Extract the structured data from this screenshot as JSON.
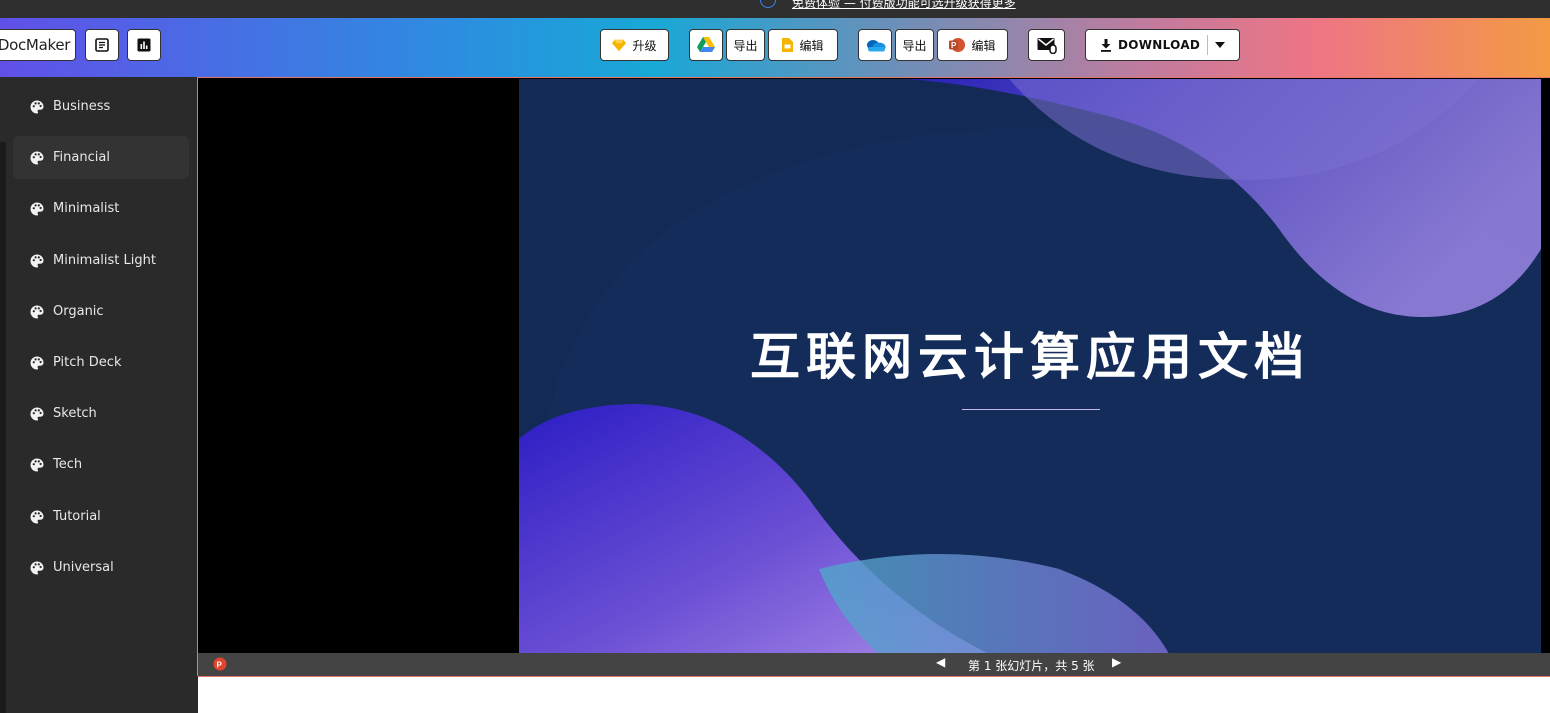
{
  "notice": {
    "text": "免费体验 — 付费版功能可选升级获得更多"
  },
  "toolbar": {
    "logo": "DocMaker",
    "upgrade_label": "升级",
    "gdrive_export_label": "导出",
    "gslides_edit_label": "编辑",
    "onedrive_export_label": "导出",
    "ppt_edit_label": "编辑",
    "download_label": "DOWNLOAD"
  },
  "sidebar": {
    "items": [
      {
        "label": "Business"
      },
      {
        "label": "Financial",
        "active": true
      },
      {
        "label": "Minimalist"
      },
      {
        "label": "Minimalist Light"
      },
      {
        "label": "Organic"
      },
      {
        "label": "Pitch Deck"
      },
      {
        "label": "Sketch"
      },
      {
        "label": "Tech"
      },
      {
        "label": "Tutorial"
      },
      {
        "label": "Universal"
      }
    ]
  },
  "slide": {
    "title": "互联网云计算应用文档"
  },
  "status": {
    "slide_count": "第 1 张幻灯片，共 5 张"
  },
  "colors": {
    "accent_border": "#e37766",
    "slide_bg": "#122a55"
  }
}
